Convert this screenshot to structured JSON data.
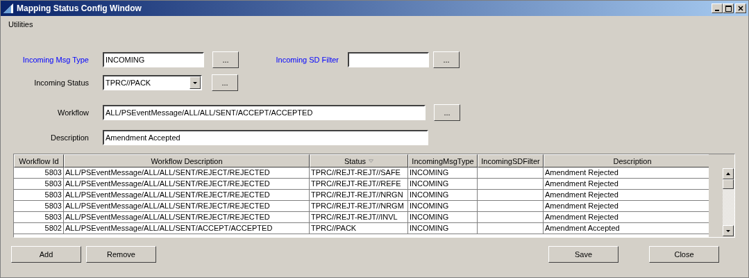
{
  "window": {
    "title": "Mapping Status Config Window"
  },
  "menu": [
    "Utilities"
  ],
  "form": {
    "incoming_msg_type": {
      "label": "Incoming Msg Type",
      "link": true,
      "value": "INCOMING",
      "button": "..."
    },
    "incoming_sd_filter": {
      "label": "Incoming SD Filter",
      "link": true,
      "button": "..."
    },
    "incoming_status": {
      "label": "Incoming Status",
      "link": false,
      "value": "TPRC//PACK",
      "button": "..."
    },
    "workflow": {
      "label": "Workflow",
      "link": false,
      "value": "ALL/PSEventMessage/ALL/ALL/SENT/ACCEPT/ACCEPTED",
      "button": "..."
    },
    "description": {
      "label": "Description",
      "link": false,
      "value": "Amendment Accepted"
    }
  },
  "table": {
    "columns": [
      {
        "label": "Workflow Id",
        "filtered": false
      },
      {
        "label": "Workflow Description",
        "filtered": false
      },
      {
        "label": "Status",
        "filtered": true
      },
      {
        "label": "IncomingMsgType",
        "filtered": false
      },
      {
        "label": "IncomingSDFilter",
        "filtered": false
      },
      {
        "label": "Description",
        "filtered": false
      }
    ],
    "rows": [
      {
        "workflow_id": "5803",
        "workflow_description": "ALL/PSEventMessage/ALL/ALL/SENT/REJECT/REJECTED",
        "status": "TPRC//REJT-REJT//SAFE",
        "incoming_msg_type": "INCOMING",
        "description": "Amendment Rejected"
      },
      {
        "workflow_id": "5803",
        "workflow_description": "ALL/PSEventMessage/ALL/ALL/SENT/REJECT/REJECTED",
        "status": "TPRC//REJT-REJT//REFE",
        "incoming_msg_type": "INCOMING",
        "description": "Amendment Rejected"
      },
      {
        "workflow_id": "5803",
        "workflow_description": "ALL/PSEventMessage/ALL/ALL/SENT/REJECT/REJECTED",
        "status": "TPRC//REJT-REJT//NRGN",
        "incoming_msg_type": "INCOMING",
        "description": "Amendment Rejected"
      },
      {
        "workflow_id": "5803",
        "workflow_description": "ALL/PSEventMessage/ALL/ALL/SENT/REJECT/REJECTED",
        "status": "TPRC//REJT-REJT//NRGM",
        "incoming_msg_type": "INCOMING",
        "description": "Amendment Rejected"
      },
      {
        "workflow_id": "5803",
        "workflow_description": "ALL/PSEventMessage/ALL/ALL/SENT/REJECT/REJECTED",
        "status": "TPRC//REJT-REJT//INVL",
        "incoming_msg_type": "INCOMING",
        "description": "Amendment Rejected"
      },
      {
        "workflow_id": "5802",
        "workflow_description": "ALL/PSEventMessage/ALL/ALL/SENT/ACCEPT/ACCEPTED",
        "status": "TPRC//PACK",
        "incoming_msg_type": "INCOMING",
        "description": "Amendment Accepted"
      }
    ]
  },
  "buttons_left": [
    "Add",
    "Remove"
  ],
  "buttons_right": [
    "Save",
    "Close"
  ]
}
